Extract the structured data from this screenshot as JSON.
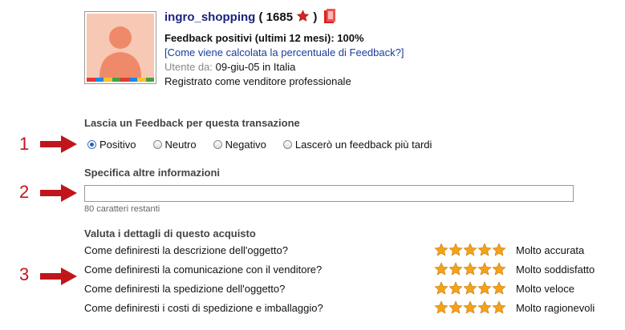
{
  "seller": {
    "username": "ingro_shopping",
    "score_open": " ( ",
    "score": "1685",
    "score_close": " )",
    "positive_feedback": "Feedback positivi (ultimi 12 mesi): 100%",
    "how_calculated_link": "[Come viene calcolata la percentuale di Feedback?]",
    "user_since_label": "Utente da:",
    "user_since_value": " 09-giu-05 in Italia",
    "registered_as": "Registrato come venditore professionale",
    "score_star_color": "#d6231b",
    "avatar_color": "#f7c8b4",
    "avatar_stripe_colors": [
      "#e53935",
      "#1e88e5",
      "#fbc02d",
      "#43a047",
      "#e53935",
      "#1e88e5",
      "#fbc02d",
      "#43a047"
    ]
  },
  "steps": [
    "1",
    "2",
    "3"
  ],
  "feedback": {
    "title": "Lascia un Feedback per questa transazione",
    "options": [
      {
        "label": "Positivo",
        "selected": true
      },
      {
        "label": "Neutro",
        "selected": false
      },
      {
        "label": "Negativo",
        "selected": false
      },
      {
        "label": "Lascerò un feedback più tardi",
        "selected": false
      }
    ]
  },
  "more_info": {
    "title": "Specifica altre informazioni",
    "comment_value": "",
    "chars_remaining": "80 caratteri restanti"
  },
  "details": {
    "title": "Valuta i dettagli di questo acquisto",
    "star_color": "#f5a21b",
    "questions": [
      {
        "question": "Come definiresti la descrizione dell'oggetto?",
        "stars": 5,
        "rating": "Molto accurata"
      },
      {
        "question": "Come definiresti la comunicazione con il venditore?",
        "stars": 5,
        "rating": "Molto soddisfatto"
      },
      {
        "question": "Come definiresti la spedizione dell'oggetto?",
        "stars": 5,
        "rating": "Molto veloce"
      },
      {
        "question": "Come definiresti i costi di spedizione e imballaggio?",
        "stars": 5,
        "rating": "Molto ragionevoli"
      }
    ]
  }
}
